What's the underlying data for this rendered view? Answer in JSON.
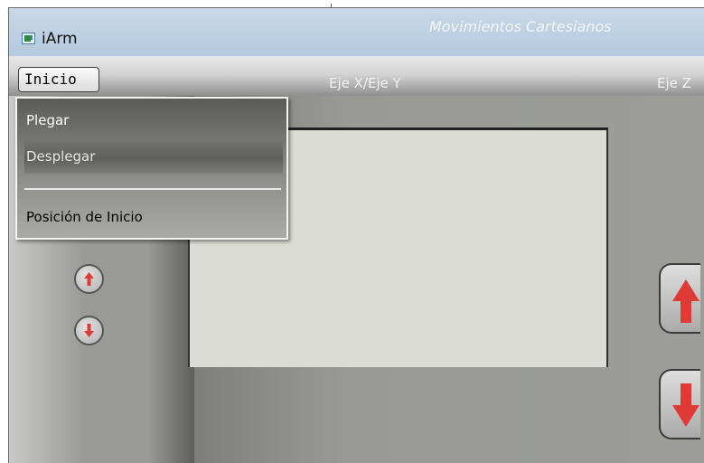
{
  "window": {
    "title": "iArm"
  },
  "menubar": {
    "inicio_label": "Inicio"
  },
  "dropdown": {
    "items": [
      {
        "label": "Plegar"
      },
      {
        "label": "Desplegar"
      },
      {
        "label": "Posición de Inicio"
      }
    ],
    "highlighted": "Desplegar"
  },
  "panel": {
    "heading": "Movimientos Cartesianos",
    "label_xy": "Eje X/Eje Y",
    "label_z": "Eje Z"
  },
  "icons": {
    "app": "app-window-icon",
    "up": "arrow-up-icon",
    "down": "arrow-down-icon"
  },
  "colors": {
    "arrow_red": "#e03a36",
    "titlebar": "#c2d3e5",
    "canvas": "#dcdcd6"
  }
}
